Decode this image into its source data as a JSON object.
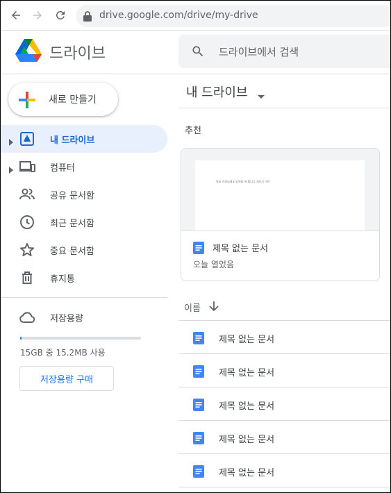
{
  "browser": {
    "url": "drive.google.com/drive/my-drive",
    "icons": [
      "back-arrow-icon",
      "forward-arrow-icon",
      "reload-icon",
      "lock-icon"
    ]
  },
  "header": {
    "brand": "드라이브",
    "search_placeholder": "드라이브에서 검색"
  },
  "sidebar": {
    "new_label": "새로 만들기",
    "items": [
      {
        "label": "내 드라이브",
        "icon": "my-drive-icon",
        "active": true
      },
      {
        "label": "컴퓨터",
        "icon": "computers-icon",
        "active": false
      },
      {
        "label": "공유 문서함",
        "icon": "shared-icon",
        "active": false
      },
      {
        "label": "최근 문서함",
        "icon": "clock-icon",
        "active": false
      },
      {
        "label": "중요 문서함",
        "icon": "star-icon",
        "active": false
      },
      {
        "label": "휴지통",
        "icon": "trash-icon",
        "active": false
      }
    ],
    "storage": {
      "label": "저장용량",
      "usage_text": "15GB 중 15.2MB 사용",
      "used_fraction": 0.01,
      "buy_label": "저장용량 구매"
    }
  },
  "main": {
    "title": "내 드라이브",
    "suggested_label": "추천",
    "card": {
      "name": "제목 없는 문서",
      "subtitle": "오늘 열었음",
      "preview_text": "필요 선생님께요 입력을 위 봤니다 개지기 미안"
    },
    "list_sort_label": "이름",
    "files": [
      {
        "name": "제목 없는 문서"
      },
      {
        "name": "제목 없는 문서"
      },
      {
        "name": "제목 없는 문서"
      },
      {
        "name": "제목 없는 문서"
      },
      {
        "name": "제목 없는 문서"
      }
    ]
  },
  "colors": {
    "accent": "#1a73e8",
    "active_bg": "#e8f0fe",
    "doc_blue": "#4285f4"
  }
}
